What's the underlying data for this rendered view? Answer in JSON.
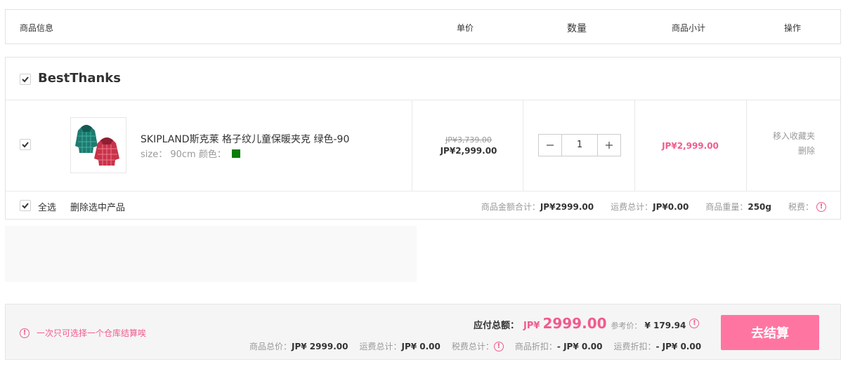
{
  "header": {
    "product_info": "商品信息",
    "unit_price": "单价",
    "quantity": "数量",
    "subtotal": "商品小计",
    "operation": "操作"
  },
  "shop": {
    "name": "BestThanks",
    "checked": true
  },
  "item": {
    "checked": true,
    "name": "SKIPLAND斯克莱 格子纹儿童保暖夹克 绿色-90",
    "size_label": "size：",
    "size_value": "90cm",
    "color_label": "颜色：",
    "color_hex": "#0a7d0a",
    "original_price": "JP¥3,739.00",
    "price": "JP¥2,999.00",
    "quantity": "1",
    "subtotal": "JP¥2,999.00",
    "action_favorite": "移入收藏夹",
    "action_delete": "删除"
  },
  "shop_footer": {
    "select_all": "全选",
    "delete_selected": "删除选中产品",
    "goods_total_label": "商品金额合计：",
    "goods_total": "JP¥2999.00",
    "shipping_label": "运费总计：",
    "shipping": "JP¥0.00",
    "weight_label": "商品重量：",
    "weight": "250g",
    "tax_label": "税费："
  },
  "checkout": {
    "warning": "一次只可选择一个仓库结算唉",
    "payable_label": "应付总额：",
    "payable_currency": "JP¥",
    "payable_amount": "2999.00",
    "reference_label": "参考价：",
    "reference_value": "¥ 179.94",
    "goods_price_label": "商品总价：",
    "goods_price": "JP¥ 2999.00",
    "shipping_total_label": "运费总计：",
    "shipping_total": "JP¥ 0.00",
    "tax_total_label": "税费总计：",
    "goods_discount_label": "商品折扣：",
    "goods_discount": "- JP¥ 0.00",
    "shipping_discount_label": "运费折扣：",
    "shipping_discount": "- JP¥ 0.00",
    "submit_label": "去结算"
  },
  "colors": {
    "accent": "#f15b8d",
    "button": "#ff75a2"
  }
}
